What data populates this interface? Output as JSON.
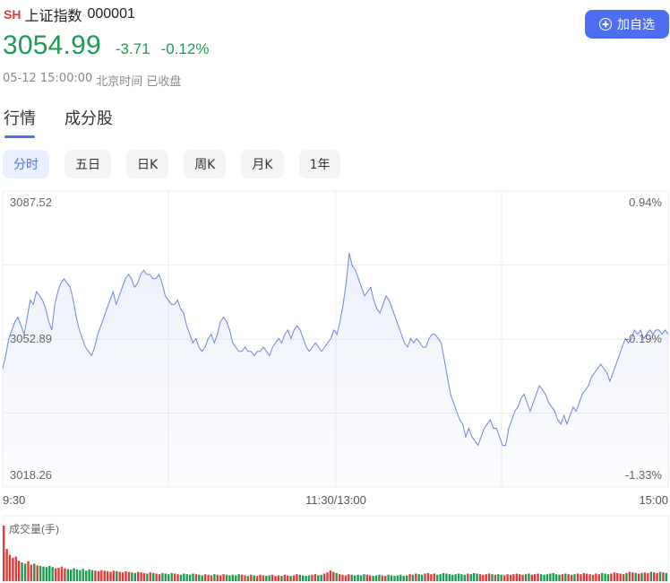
{
  "header": {
    "market_tag": "SH",
    "name": "上证指数",
    "code": "000001",
    "price": "3054.99",
    "change": "-3.71",
    "change_pct": "-0.12%",
    "time": "05-12 15:00:00",
    "timezone_label": "北京时间",
    "status": "已收盘",
    "add_button_label": "加自选"
  },
  "tabs": [
    {
      "label": "行情",
      "active": true
    },
    {
      "label": "成分股",
      "active": false
    }
  ],
  "periods": [
    {
      "label": "分时",
      "active": true
    },
    {
      "label": "五日",
      "active": false
    },
    {
      "label": "日K",
      "active": false
    },
    {
      "label": "周K",
      "active": false
    },
    {
      "label": "月K",
      "active": false
    },
    {
      "label": "1年",
      "active": false
    }
  ],
  "colors": {
    "down": "#1a9c52",
    "up": "#e23b3b",
    "accent": "#4e6ef2",
    "line": "#6b86e0"
  },
  "chart_data": {
    "type": "line",
    "y_left_labels": [
      "3087.52",
      "3052.89",
      "3018.26"
    ],
    "y_right_labels": [
      "0.94%",
      "-0.19%",
      "-1.33%"
    ],
    "ylim": [
      3018.26,
      3087.52
    ],
    "prev_close": 3052.89,
    "x_labels": [
      "9:30",
      "11:30/13:00",
      "15:00"
    ],
    "series": [
      {
        "values": [
          3046,
          3049,
          3053,
          3055,
          3057,
          3058,
          3056,
          3054,
          3058,
          3062,
          3061,
          3064,
          3063,
          3062,
          3060,
          3057,
          3055,
          3061,
          3064,
          3066,
          3067,
          3066,
          3065,
          3062,
          3058,
          3055,
          3053,
          3051,
          3050,
          3049,
          3051,
          3054,
          3056,
          3058,
          3060,
          3062,
          3064,
          3061,
          3063,
          3065,
          3067,
          3068,
          3067,
          3065,
          3066,
          3068,
          3069,
          3068,
          3068,
          3067,
          3067,
          3068,
          3066,
          3063,
          3062,
          3061,
          3061,
          3062,
          3060,
          3059,
          3056,
          3054,
          3052,
          3053,
          3051,
          3050,
          3051,
          3053,
          3054,
          3052,
          3054,
          3057,
          3058,
          3057,
          3055,
          3052,
          3051,
          3050,
          3050,
          3051,
          3050,
          3050,
          3049,
          3050,
          3050,
          3051,
          3050,
          3049,
          3051,
          3052,
          3053,
          3052,
          3054,
          3055,
          3053,
          3055,
          3056,
          3055,
          3053,
          3051,
          3050,
          3051,
          3052,
          3051,
          3050,
          3051,
          3052,
          3053,
          3055,
          3054,
          3057,
          3061,
          3066,
          3073,
          3070,
          3069,
          3067,
          3065,
          3063,
          3064,
          3065,
          3062,
          3060,
          3059,
          3061,
          3063,
          3062,
          3060,
          3058,
          3056,
          3054,
          3052,
          3051,
          3053,
          3052,
          3053,
          3052,
          3051,
          3051,
          3053,
          3054,
          3054,
          3053,
          3052,
          3048,
          3044,
          3040,
          3038,
          3036,
          3034,
          3033,
          3030,
          3032,
          3030,
          3029,
          3028,
          3030,
          3032,
          3033,
          3034,
          3032,
          3032,
          3030,
          3028,
          3028,
          3032,
          3034,
          3036,
          3037,
          3039,
          3040,
          3038,
          3036,
          3038,
          3040,
          3042,
          3041,
          3040,
          3038,
          3037,
          3036,
          3034,
          3033,
          3035,
          3033,
          3035,
          3037,
          3036,
          3038,
          3040,
          3041,
          3042,
          3044,
          3045,
          3046,
          3047,
          3046,
          3045,
          3043,
          3045,
          3047,
          3049,
          3051,
          3053,
          3052,
          3053,
          3055,
          3054,
          3055,
          3053,
          3054,
          3055,
          3054,
          3055,
          3055,
          3054,
          3055,
          3054
        ]
      }
    ],
    "volume_label": "成交量(手)",
    "volume": [
      95,
      55,
      45,
      40,
      42,
      35,
      32,
      30,
      34,
      28,
      30,
      27,
      26,
      25,
      24,
      26,
      24,
      22,
      23,
      25,
      22,
      21,
      20,
      22,
      20,
      19,
      21,
      18,
      20,
      19,
      18,
      17,
      19,
      18,
      17,
      16,
      18,
      17,
      16,
      15,
      17,
      16,
      15,
      14,
      16,
      15,
      14,
      13,
      15,
      14,
      13,
      12,
      14,
      13,
      12,
      14,
      13,
      12,
      11,
      13,
      12,
      11,
      13,
      12,
      11,
      10,
      12,
      11,
      10,
      12,
      11,
      10,
      12,
      11,
      10,
      11,
      10,
      12,
      11,
      10,
      9,
      11,
      10,
      9,
      11,
      10,
      9,
      10,
      11,
      9,
      10,
      9,
      11,
      10,
      9,
      10,
      12,
      11,
      10,
      9,
      10,
      11,
      12,
      10,
      11,
      13,
      15,
      18,
      16,
      14,
      12,
      11,
      10,
      12,
      11,
      10,
      11,
      10,
      12,
      11,
      10,
      9,
      10,
      11,
      10,
      9,
      11,
      10,
      9,
      10,
      11,
      9,
      10,
      12,
      11,
      13,
      12,
      11,
      13,
      14,
      12,
      13,
      11,
      12,
      14,
      13,
      12,
      11,
      12,
      13,
      12,
      11,
      13,
      12,
      14,
      13,
      12,
      11,
      12,
      13,
      12,
      11,
      12,
      11,
      10,
      12,
      11,
      12,
      13,
      12,
      11,
      12,
      13,
      11,
      12,
      13,
      12,
      11,
      12,
      13,
      14,
      12,
      11,
      12,
      13,
      12,
      11,
      12,
      13,
      12,
      14,
      13,
      12,
      11,
      13,
      12,
      14,
      13,
      12,
      13,
      15,
      14,
      13,
      12,
      14,
      16,
      15,
      14,
      13,
      14,
      15,
      14,
      16,
      15,
      14,
      16,
      15,
      14
    ]
  }
}
